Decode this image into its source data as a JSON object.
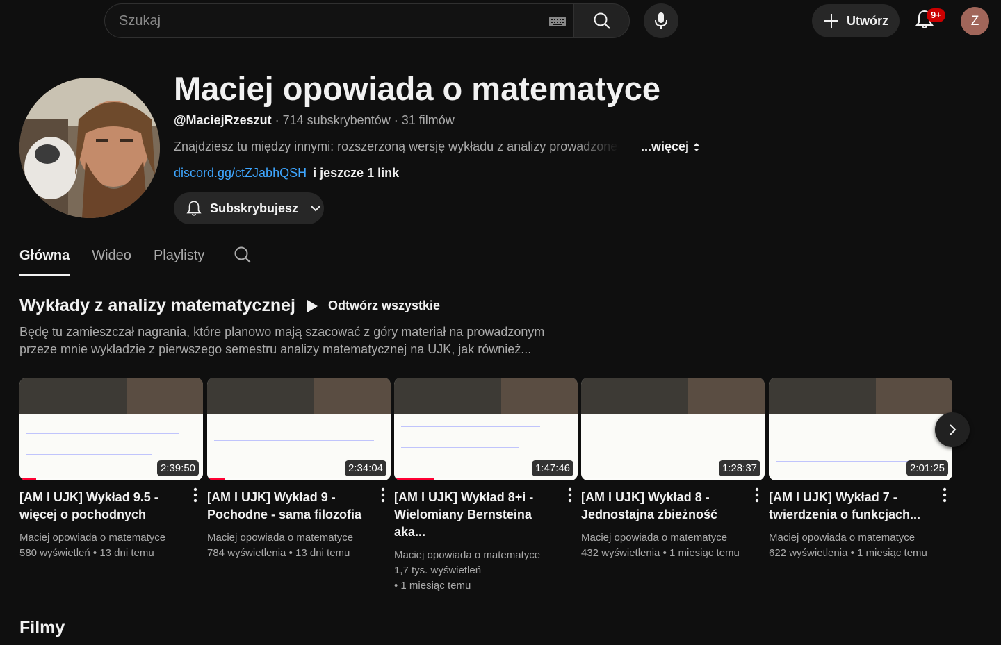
{
  "search": {
    "placeholder": "Szukaj"
  },
  "header": {
    "create_label": "Utwórz",
    "notifications_badge": "9+",
    "avatar_letter": "Z"
  },
  "channel": {
    "title": "Maciej opowiada o matematyce",
    "handle": "@MaciejRzeszut",
    "subscribers": "714 subskrybentów",
    "videos": "31 filmów",
    "description": "Znajdziesz tu między innymi: rozszerzoną wersję wykładu z analizy prowadzonego p",
    "more_label": "...więcej",
    "link": "discord.gg/ctZJabhQSH",
    "extra_links": "i jeszcze 1 link",
    "subscribe_label": "Subskrybujesz"
  },
  "tabs": [
    {
      "label": "Główna",
      "active": true
    },
    {
      "label": "Wideo",
      "active": false
    },
    {
      "label": "Playlisty",
      "active": false
    }
  ],
  "shelf": {
    "title": "Wykłady z analizy matematycznej",
    "play_all_label": "Odtwórz wszystkie",
    "description": "Będę tu zamieszczał nagrania, które planowo mają szacować z góry materiał na prowadzonym przeze mnie wykładzie z pierwszego semestru analizy matematycznej na UJK, jak również...",
    "videos": [
      {
        "title": "[AM I UJK] Wykład 9.5 - więcej o pochodnych",
        "channel": "Maciej opowiada o matematyce",
        "views": "580 wyświetleń",
        "age": "13 dni temu",
        "duration": "2:39:50",
        "progress": 0.09
      },
      {
        "title": "[AM I UJK] Wykład 9 - Pochodne - sama filozofia",
        "channel": "Maciej opowiada o matematyce",
        "views": "784 wyświetlenia",
        "age": "13 dni temu",
        "duration": "2:34:04",
        "progress": 0.1
      },
      {
        "title": "[AM I UJK] Wykład 8+i - Wielomiany Bernsteina aka...",
        "channel": "Maciej opowiada o matematyce",
        "views": "1,7 tys. wyświetleń",
        "age": "1 miesiąc temu",
        "duration": "1:47:46",
        "progress": 0.22
      },
      {
        "title": "[AM I UJK] Wykład 8 - Jednostajna zbieżność",
        "channel": "Maciej opowiada o matematyce",
        "views": "432 wyświetlenia",
        "age": "1 miesiąc temu",
        "duration": "1:28:37",
        "progress": 0
      },
      {
        "title": "[AM I UJK] Wykład 7 - twierdzenia o funkcjach...",
        "channel": "Maciej opowiada o matematyce",
        "views": "622 wyświetlenia",
        "age": "1 miesiąc temu",
        "duration": "2:01:25",
        "progress": 0
      }
    ]
  },
  "films_section": {
    "title": "Filmy"
  },
  "colors": {
    "background": "#0f0f0f",
    "link": "#3ea6ff",
    "progress": "#ff0033",
    "badge": "#cc0000",
    "avatar": "#a1665a"
  }
}
